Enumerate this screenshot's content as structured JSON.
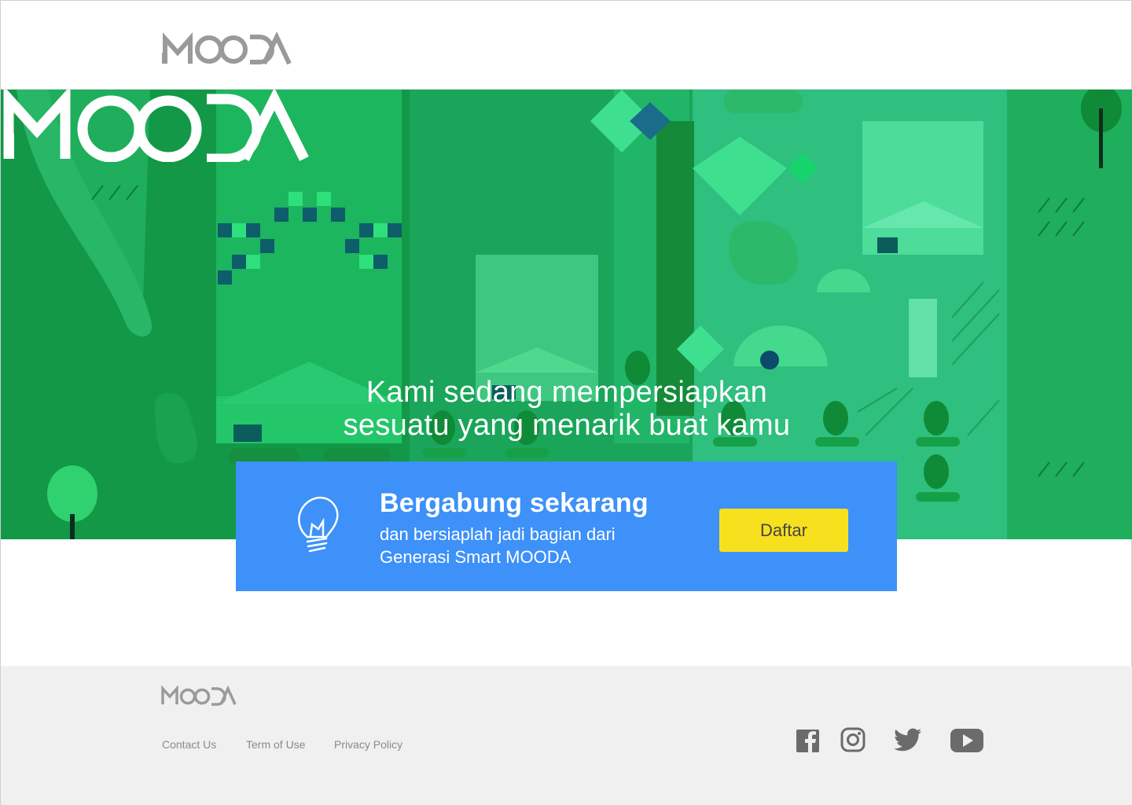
{
  "header": {
    "logo_text": "MOODA"
  },
  "hero": {
    "logo_text": "MOODA",
    "line1": "Kami sedang mempersiapkan",
    "line2": "sesuatu yang menarik buat kamu"
  },
  "cta": {
    "title": "Bergabung sekarang",
    "subtitle_line1": "dan bersiaplah jadi bagian dari",
    "subtitle_line2": "Generasi Smart MOODA",
    "button_label": "Daftar"
  },
  "footer": {
    "logo_text": "MOODA",
    "links": [
      "Contact Us",
      "Term of Use",
      "Privacy Policy"
    ],
    "social_icons": [
      "facebook-icon",
      "instagram-icon",
      "twitter-icon",
      "youtube-icon"
    ]
  },
  "colors": {
    "hero_green": "#1aa55a",
    "cta_blue": "#3d91f8",
    "button_yellow": "#f7e01e",
    "footer_bg": "#f0f0f0",
    "logo_gray": "#9a9a9a"
  }
}
